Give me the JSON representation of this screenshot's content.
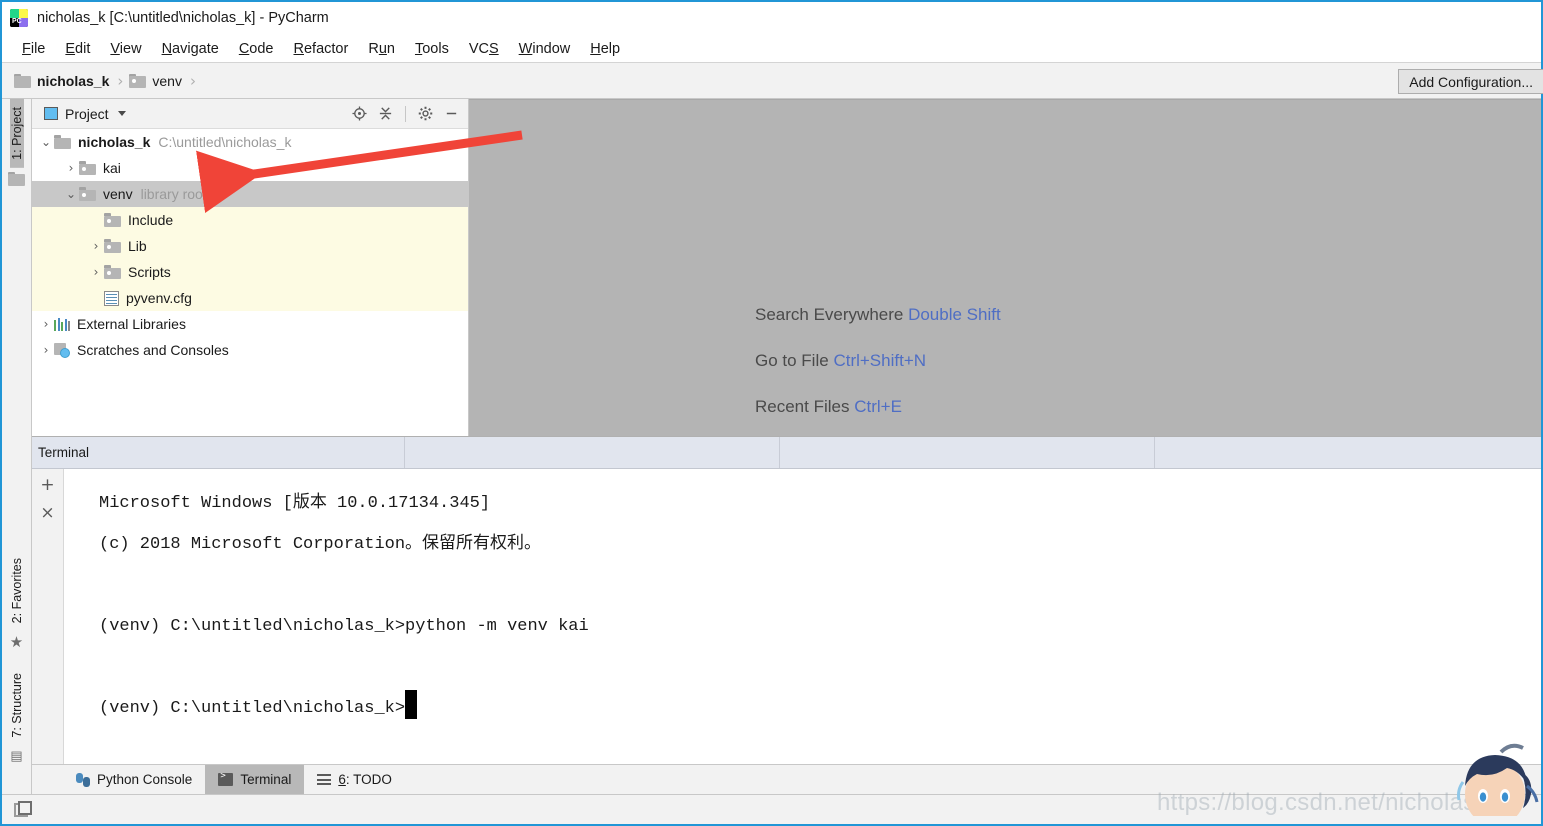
{
  "window": {
    "title": "nicholas_k [C:\\untitled\\nicholas_k] - PyCharm",
    "logo_icon": "pycharm-logo-icon",
    "logo_text": "PC"
  },
  "menu": {
    "items": [
      {
        "label": "File",
        "mnemonic": "F"
      },
      {
        "label": "Edit",
        "mnemonic": "E"
      },
      {
        "label": "View",
        "mnemonic": "V"
      },
      {
        "label": "Navigate",
        "mnemonic": "N"
      },
      {
        "label": "Code",
        "mnemonic": "C"
      },
      {
        "label": "Refactor",
        "mnemonic": "R"
      },
      {
        "label": "Run",
        "mnemonic": "R"
      },
      {
        "label": "Tools",
        "mnemonic": "T"
      },
      {
        "label": "VCS",
        "mnemonic": "S"
      },
      {
        "label": "Window",
        "mnemonic": "W"
      },
      {
        "label": "Help",
        "mnemonic": "H"
      }
    ]
  },
  "navbar": {
    "crumbs": [
      {
        "label": "nicholas_k",
        "icon": "folder-icon",
        "bold": true
      },
      {
        "label": "venv",
        "icon": "folder-icon",
        "bold": false
      }
    ],
    "separator": "›",
    "add_configuration_label": "Add Configuration..."
  },
  "left_strip": {
    "top_tabs": [
      {
        "label": "1: Project",
        "mnemonic": "1",
        "active": true,
        "icon": "project-folder-icon"
      }
    ],
    "bottom_tabs": [
      {
        "label": "2: Favorites",
        "mnemonic": "2",
        "active": false,
        "icon": "star-icon"
      },
      {
        "label": "7: Structure",
        "mnemonic": "7",
        "active": false,
        "icon": "structure-icon"
      }
    ]
  },
  "project_panel": {
    "title": "Project",
    "title_icon": "project-view-icon",
    "dropdown_icon": "chevron-down-icon",
    "tools": [
      {
        "name": "locate-icon",
        "glyph": "⊕"
      },
      {
        "name": "collapse-all-icon",
        "glyph": "⇵"
      },
      {
        "name": "settings-gear-icon",
        "glyph": "⚙"
      },
      {
        "name": "minimize-icon",
        "glyph": "−"
      }
    ],
    "tree": [
      {
        "label": "nicholas_k",
        "note": "C:\\untitled\\nicholas_k",
        "indent": 0,
        "arrow": "⌄",
        "icon": "folder-icon",
        "bold": true,
        "state": "normal"
      },
      {
        "label": "kai",
        "note": "",
        "indent": 1,
        "arrow": "›",
        "icon": "folder-dotted-icon",
        "bold": false,
        "state": "normal"
      },
      {
        "label": "venv",
        "note": "library root",
        "indent": 1,
        "arrow": "⌄",
        "icon": "folder-dotted-icon",
        "bold": false,
        "state": "selected"
      },
      {
        "label": "Include",
        "note": "",
        "indent": 2,
        "arrow": "",
        "icon": "folder-dotted-icon",
        "bold": false,
        "state": "excluded"
      },
      {
        "label": "Lib",
        "note": "",
        "indent": 2,
        "arrow": "›",
        "icon": "folder-dotted-icon",
        "bold": false,
        "state": "excluded"
      },
      {
        "label": "Scripts",
        "note": "",
        "indent": 2,
        "arrow": "›",
        "icon": "folder-dotted-icon",
        "bold": false,
        "state": "excluded"
      },
      {
        "label": "pyvenv.cfg",
        "note": "",
        "indent": 2,
        "arrow": "",
        "icon": "config-file-icon",
        "bold": false,
        "state": "excluded"
      },
      {
        "label": "External Libraries",
        "note": "",
        "indent": 0,
        "arrow": "›",
        "icon": "library-bars-icon",
        "bold": false,
        "state": "normal"
      },
      {
        "label": "Scratches and Consoles",
        "note": "",
        "indent": 0,
        "arrow": "›",
        "icon": "scratches-icon",
        "bold": false,
        "state": "normal"
      }
    ]
  },
  "editor": {
    "hints": [
      {
        "action": "Search Everywhere",
        "shortcut": "Double Shift"
      },
      {
        "action": "Go to File",
        "shortcut": "Ctrl+Shift+N"
      },
      {
        "action": "Recent Files",
        "shortcut": "Ctrl+E"
      }
    ],
    "shortcut_color": "#4f6ec4",
    "background_color": "#b4b4b4"
  },
  "terminal": {
    "tab_label": "Terminal",
    "gutter_buttons": [
      {
        "name": "new-session-button",
        "glyph": "+"
      },
      {
        "name": "close-session-button",
        "glyph": "×"
      }
    ],
    "lines": [
      "Microsoft Windows [版本 10.0.17134.345]",
      "(c) 2018 Microsoft Corporation。保留所有权利。",
      "",
      "(venv) C:\\untitled\\nicholas_k>python -m venv kai",
      "",
      "(venv) C:\\untitled\\nicholas_k>"
    ]
  },
  "bottom_tabs": {
    "items": [
      {
        "label": "Python Console",
        "icon": "python-icon",
        "active": false,
        "mnemonic": ""
      },
      {
        "label": "Terminal",
        "icon": "terminal-icon",
        "active": true,
        "mnemonic": ""
      },
      {
        "label": "6: TODO",
        "icon": "todo-list-icon",
        "active": false,
        "mnemonic": "6"
      }
    ]
  },
  "statusbar": {
    "icon": "window-stack-icon"
  },
  "annotations": {
    "arrow": {
      "name": "red-arrow-annotation",
      "color": "#f04438",
      "points_to": "kai"
    },
    "watermark": "https://blog.csdn.net/nicholas_k"
  }
}
